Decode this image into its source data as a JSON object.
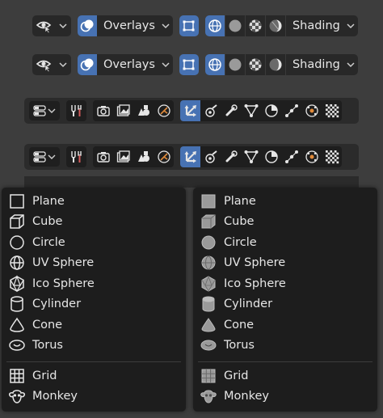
{
  "header_rows": [
    {
      "overlays_label": "Overlays",
      "shading_label": "Shading"
    },
    {
      "overlays_label": "Overlays",
      "shading_label": "Shading"
    }
  ],
  "add_menus": [
    {
      "style": "outline",
      "items": [
        {
          "label": "Plane",
          "icon": "plane-icon"
        },
        {
          "label": "Cube",
          "icon": "cube-icon"
        },
        {
          "label": "Circle",
          "icon": "circle-icon"
        },
        {
          "label": "UV Sphere",
          "icon": "uv-sphere-icon"
        },
        {
          "label": "Ico Sphere",
          "icon": "ico-sphere-icon"
        },
        {
          "label": "Cylinder",
          "icon": "cylinder-icon"
        },
        {
          "label": "Cone",
          "icon": "cone-icon"
        },
        {
          "label": "Torus",
          "icon": "torus-icon"
        },
        {
          "label": "Grid",
          "icon": "grid-icon"
        },
        {
          "label": "Monkey",
          "icon": "monkey-icon"
        }
      ]
    },
    {
      "style": "filled",
      "items": [
        {
          "label": "Plane",
          "icon": "plane-icon"
        },
        {
          "label": "Cube",
          "icon": "cube-icon"
        },
        {
          "label": "Circle",
          "icon": "circle-icon"
        },
        {
          "label": "UV Sphere",
          "icon": "uv-sphere-icon"
        },
        {
          "label": "Ico Sphere",
          "icon": "ico-sphere-icon"
        },
        {
          "label": "Cylinder",
          "icon": "cylinder-icon"
        },
        {
          "label": "Cone",
          "icon": "cone-icon"
        },
        {
          "label": "Torus",
          "icon": "torus-icon"
        },
        {
          "label": "Grid",
          "icon": "grid-icon"
        },
        {
          "label": "Monkey",
          "icon": "monkey-icon"
        }
      ]
    }
  ],
  "colors": {
    "accent": "#4772b3",
    "background": "#3d3d3d",
    "menu_bg": "#1d1d1d"
  }
}
